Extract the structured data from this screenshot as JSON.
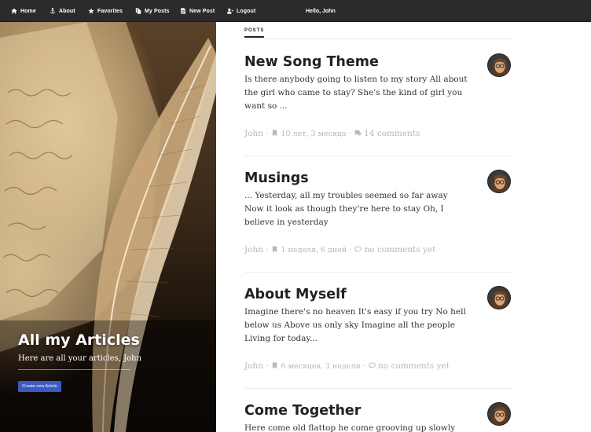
{
  "nav": {
    "items": [
      {
        "label": "Home",
        "icon": "home-icon"
      },
      {
        "label": "About",
        "icon": "anchor-icon"
      },
      {
        "label": "Favorites",
        "icon": "star-icon"
      },
      {
        "label": "My Posts",
        "icon": "copy-icon"
      },
      {
        "label": "New Post",
        "icon": "document-icon"
      },
      {
        "label": "Logout",
        "icon": "user-logout-icon"
      }
    ],
    "greeting": "Hello, John"
  },
  "hero": {
    "title": "All my Articles",
    "subtitle": "Here are all your articles, John",
    "button_label": "Create new Article"
  },
  "posts_tab": "POSTS",
  "posts": [
    {
      "title": "New Song Theme",
      "excerpt": "Is there anybody going to listen to my story All about the girl who came to stay? She's the kind of girl you want so ...",
      "author": "John",
      "date": "10 лет, 3 месяца",
      "comments": "14 comments"
    },
    {
      "title": "Musings",
      "excerpt": "... Yesterday, all my troubles seemed so far away Now it look as though they're here to stay Oh, I believe in yesterday",
      "author": "John",
      "date": "1 неделя, 6 дней",
      "comments": "no comments yet"
    },
    {
      "title": "About Myself",
      "excerpt": "Imagine there's no heaven It's easy if you try No hell below us Above us only sky Imagine all the people Living for today...",
      "author": "John",
      "date": "6 месяцев, 3 недели",
      "comments": "no comments yet"
    },
    {
      "title": "Come Together",
      "excerpt": "Here come old flattop he come grooving up slowly He",
      "author": "John",
      "date": "",
      "comments": ""
    }
  ],
  "colors": {
    "nav_bg": "#2b2b2e",
    "button_bg": "#3c5ac0",
    "meta_text": "#b7b7b7"
  }
}
